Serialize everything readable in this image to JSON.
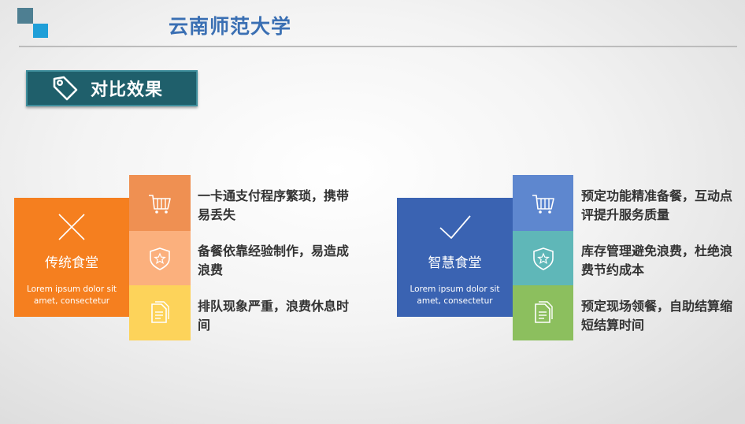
{
  "header": {
    "university": "云南师范大学",
    "section_title": "对比效果"
  },
  "traditional": {
    "title": "传统食堂",
    "lorem": "Lorem ipsum dolor sit amet, consectetur",
    "items": [
      {
        "icon": "cart-icon",
        "text": "一卡通支付程序繁琐，携带易丢失"
      },
      {
        "icon": "badge-star-icon",
        "text": "备餐依靠经验制作，易造成浪费"
      },
      {
        "icon": "document-icon",
        "text": "排队现象严重，浪费休息时间"
      }
    ]
  },
  "smart": {
    "title": "智慧食堂",
    "lorem": "Lorem ipsum dolor sit amet, consectetur",
    "items": [
      {
        "icon": "cart-icon",
        "text": "预定功能精准备餐，互动点评提升服务质量"
      },
      {
        "icon": "badge-star-icon",
        "text": "库存管理避免浪费，杜绝浪费节约成本"
      },
      {
        "icon": "document-icon",
        "text": "预定现场领餐，自助结算缩短结算时间"
      }
    ]
  },
  "colors": {
    "header_blue": "#3a6fb3",
    "section_bg": "#1f5f6b",
    "trad_main": "#f57f1f",
    "trad_1": "#ef9052",
    "trad_2": "#fbb07d",
    "trad_3": "#fdd35a",
    "smart_main": "#3a63b2",
    "smart_1": "#5e87cf",
    "smart_2": "#5fb7b8",
    "smart_3": "#8cbf5e"
  }
}
